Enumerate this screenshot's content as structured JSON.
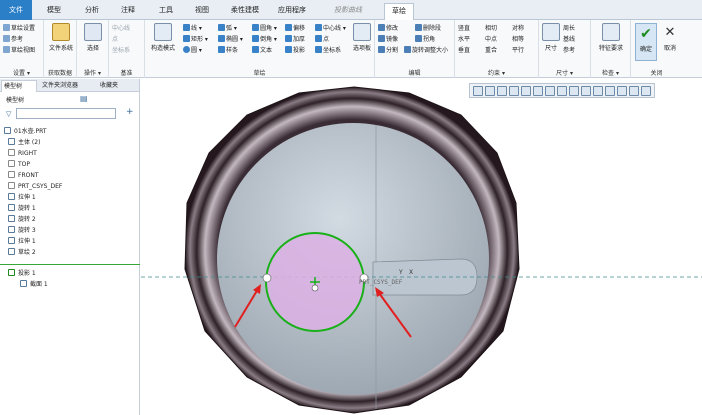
{
  "tabs": [
    "文件",
    "模型",
    "分析",
    "注释",
    "工具",
    "视图",
    "柔性建模",
    "应用程序",
    "投影曲线",
    "草绘"
  ],
  "ribbon": {
    "setup": {
      "items": [
        "草绘设置",
        "参考",
        "草绘视图"
      ],
      "label": "设置 ▾"
    },
    "datum_get": {
      "btn": "文件系统",
      "label": "获取数据"
    },
    "operations": {
      "btn": "选择",
      "label": "操作 ▾"
    },
    "datum": {
      "items": [
        "中心线",
        "点",
        "坐标系"
      ],
      "label": "基准"
    },
    "construction": "构造模式",
    "sketch": {
      "col1": [
        "线 ▾",
        "矩形 ▾",
        "圆 ▾"
      ],
      "col2": [
        "弧 ▾",
        "椭圆 ▾",
        "样条"
      ],
      "col3": [
        "圆角 ▾",
        "倒角 ▾",
        "文本"
      ],
      "col4": [
        "偏移",
        "加厚",
        "投影"
      ],
      "col5": [
        "中心线 ▾",
        "点",
        "坐标系"
      ],
      "palette": "选项板",
      "label": "草绘"
    },
    "edit": {
      "items": [
        "修改",
        "删除段",
        "镜像",
        "拐角",
        "分割",
        "旋转调整大小"
      ],
      "label": "编辑"
    },
    "constrain": {
      "items": [
        "竖直",
        "相切",
        "对称",
        "水平",
        "中点",
        "相等",
        "垂直",
        "重合",
        "平行"
      ],
      "label": "约束 ▾"
    },
    "dimension": {
      "btn": "尺寸",
      "items": [
        "周长",
        "基线",
        "参考"
      ],
      "label": "尺寸 ▾"
    },
    "inspect": {
      "btn": "特征要求",
      "label": "检查 ▾"
    },
    "close": {
      "ok": "确定",
      "cancel": "取消",
      "label": "关闭"
    }
  },
  "panel": {
    "tabs": [
      "模型树",
      "文件夹浏览器",
      "收藏夹"
    ],
    "header": "模型树",
    "tree": [
      "01水壶.PRT",
      "主体 (2)",
      "RIGHT",
      "TOP",
      "FRONT",
      "PRT_CSYS_DEF",
      "拉伸 1",
      "旋转 1",
      "旋转 2",
      "旋转 3",
      "拉伸 1",
      "草绘 2"
    ],
    "tree2": [
      "投影 1",
      "截面 1"
    ]
  },
  "viewport": {
    "label_prt": "PRT_CSYS_DEF",
    "label_y": "Y",
    "label_x": "X"
  },
  "colors": {
    "accent": "#2a7fc7",
    "sketch_green": "#19b019",
    "fill_pink": "#dcb0e4",
    "arrow_red": "#e02020",
    "body_grey": "#b6c0ca"
  }
}
